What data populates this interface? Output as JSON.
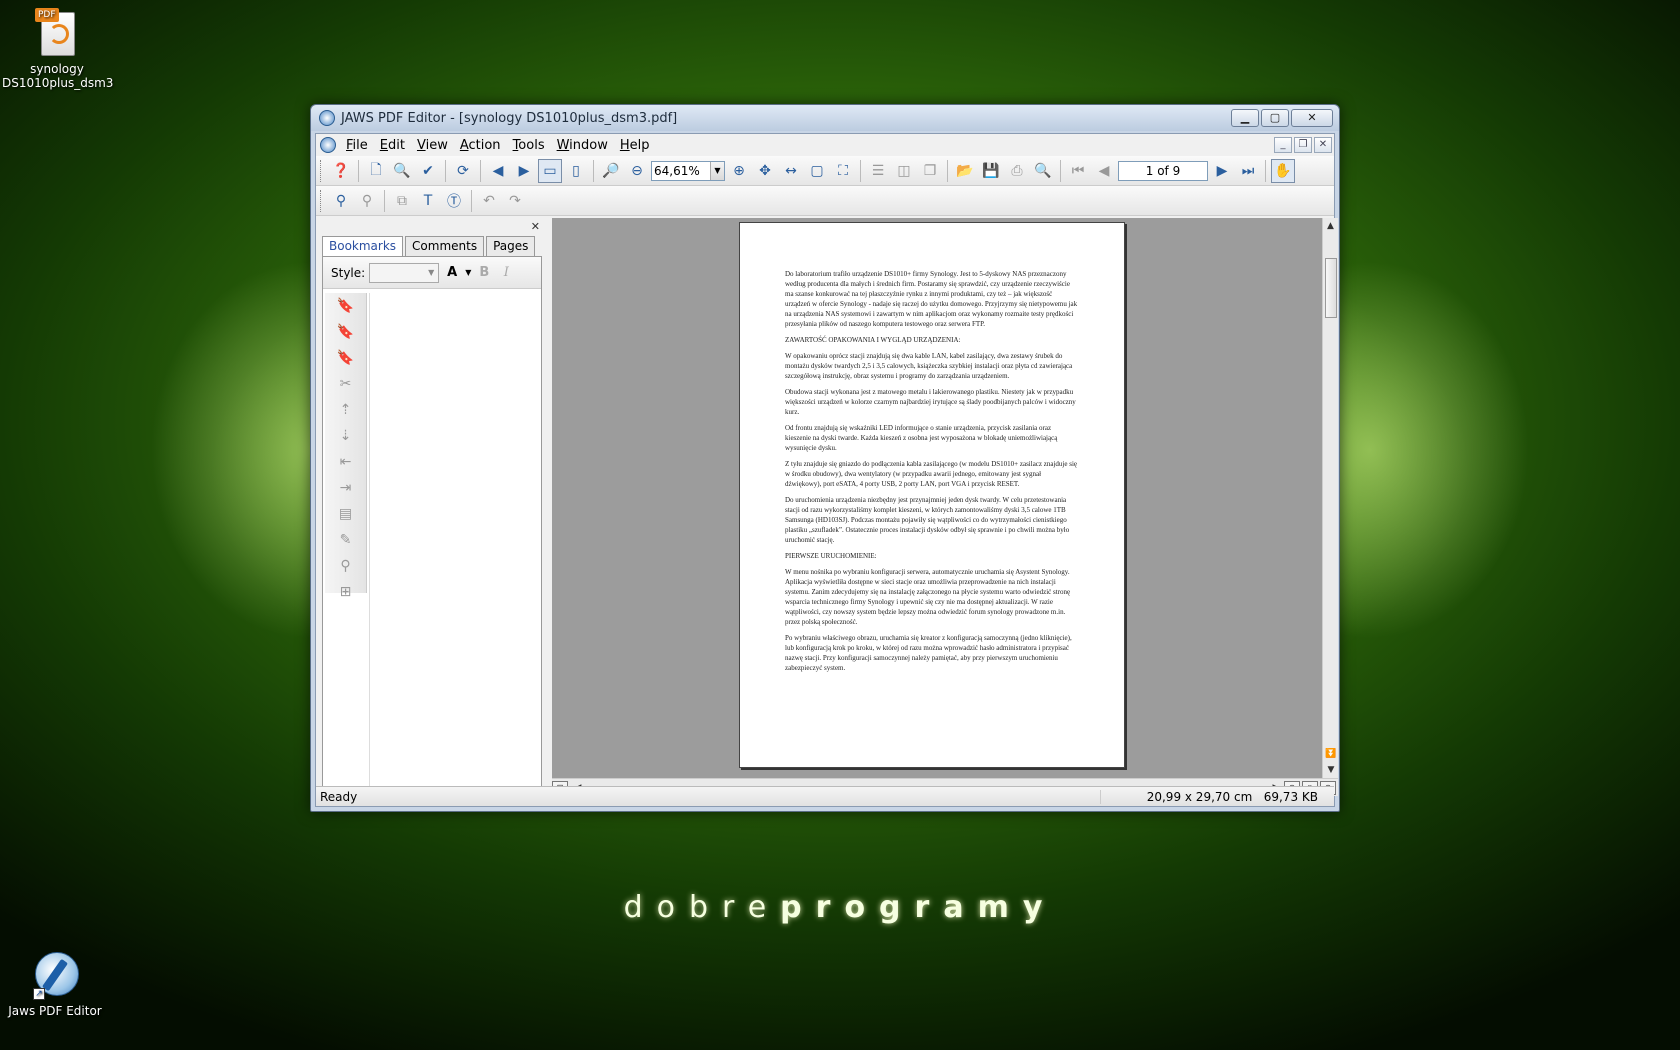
{
  "desktop": {
    "icon_pdf": {
      "tag": "PDF",
      "label_line1": "synology",
      "label_line2": "DS1010plus_dsm3"
    },
    "icon_app": {
      "label": "Jaws PDF Editor"
    },
    "brand_light": "dobre",
    "brand_bold": "programy"
  },
  "window": {
    "title": "JAWS PDF Editor - [synology DS1010plus_dsm3.pdf]",
    "minimize": "▁",
    "maximize": "▢",
    "close": "✕"
  },
  "menu": {
    "items": [
      "File",
      "Edit",
      "View",
      "Action",
      "Tools",
      "Window",
      "Help"
    ],
    "mdi_minimize": "_",
    "mdi_restore": "❐",
    "mdi_close": "✕"
  },
  "toolbar": {
    "zoom": "64,61%",
    "page": "1 of 9"
  },
  "panel": {
    "close": "✕",
    "tabs": [
      "Bookmarks",
      "Comments",
      "Pages"
    ],
    "active_tab": "Bookmarks",
    "style_label": "Style:",
    "font_color": "A",
    "bold": "B",
    "italic": "I"
  },
  "document": {
    "paragraphs": [
      "Do laboratorium trafiło urządzenie DS1010+ firmy Synology. Jest to 5-dyskowy NAS przeznaczony według producenta dla małych i średnich firm. Postaramy się sprawdzić, czy urządzenie rzeczywiście ma szanse konkurować na tej płaszczyźnie rynku z innymi produktami, czy też – jak większość urządzeń w ofercie Synology - nadaje się raczej do użytku domowego. Przyjrzymy się nietypowemu jak na urządzenia NAS systemowi i zawartym w nim aplikacjom oraz wykonamy rozmaite testy prędkości przesyłania plików od naszego komputera testowego oraz serwera FTP.",
      "ZAWARTOŚĆ OPAKOWANIA I WYGLĄD URZĄDZENIA:",
      "W opakowaniu oprócz stacji znajdują się dwa kable LAN, kabel zasilający, dwa zestawy śrubek do montażu dysków twardych 2,5 i 3,5 calowych, książeczka szybkiej instalacji oraz płyta cd zawierająca szczegółową instrukcję, obraz systemu i programy do zarządzania urządzeniem.",
      "Obudowa stacji wykonana jest z matowego metalu i lakierowanego plastiku. Niestety jak w przypadku większości urządzeń w kolorze czarnym najbardziej irytujące są ślady poodbijanych palców i widoczny kurz.",
      "Od frontu znajdują się wskaźniki LED informujące o stanie urządzenia, przycisk zasilania oraz kieszenie na dyski twarde. Każda kieszeń z osobna jest wyposażona w blokadę uniemożliwiającą wysunięcie dysku.",
      "Z tyłu znajduje się gniazdo do podłączenia kabla zasilającego (w modelu DS1010+ zasilacz znajduje się w środku obudowy), dwa wentylatory (w przypadku awarii jednego, emitowany jest sygnał dźwiękowy), port eSATA, 4 porty USB, 2 porty LAN, port VGA i przycisk RESET.",
      "Do uruchomienia urządzenia niezbędny jest przynajmniej jeden dysk twardy. W celu przetestowania stacji od razu wykorzystaliśmy komplet kieszeni, w których zamontowaliśmy dyski 3,5 calowe 1TB Samsunga (HD103SJ). Podczas montażu pojawiły się wątpliwości co do wytrzymałości cienistkiego plastiku „szufladek”. Ostatecznie proces instalacji dysków odbył się sprawnie i po chwili można było uruchomić stację.",
      "PIERWSZE URUCHOMIENIE:",
      "W menu nośnika po wybraniu konfiguracji serwera, automatycznie uruchamia się Asystent Synology. Aplikacja wyświetliła dostępne w sieci stacje oraz umożliwia przeprowadzenie na nich instalacji systemu. Zanim zdecydujemy się na instalację załączonego na płycie systemu warto odwiedzić stronę wsparcia technicznego firmy Synology i upewnić się czy nie ma dostępnej aktualizacji. W razie wątpliwości, czy nowszy system będzie lepszy można odwiedzić forum synology prowadzone m.in. przez polską społeczność.",
      "Po wybraniu właściwego obrazu, uruchamia się kreator z konfiguracją samoczynną (jedno kliknięcie), lub konfiguracją krok po kroku, w której od razu można wprowadzić hasło administratora i przypisać nazwę stacji. Przy konfiguracji samoczynnej należy pamiętać, aby przy pierwszym uruchomieniu zabezpieczyć system."
    ]
  },
  "status": {
    "left": "Ready",
    "size": "20,99 x 29,70 cm",
    "filesize": "69,73 KB"
  }
}
